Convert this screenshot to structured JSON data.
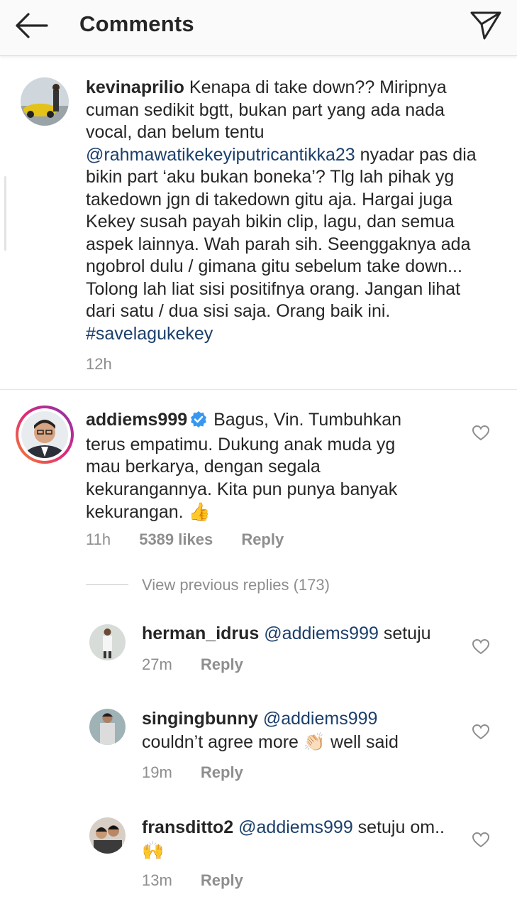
{
  "header": {
    "title": "Comments"
  },
  "main_comment": {
    "username": "kevinaprilio",
    "text_before": "Kenapa di take down?? Miripnya cuman sedikit bgtt, bukan part yang ada nada vocal, dan belum tentu ",
    "mention": "@rahmawatikekeyiputricantikka23",
    "text_after": " nyadar pas dia bikin part ‘aku bukan boneka’? Tlg lah pihak yg takedown jgn di takedown gitu aja. Hargai juga Kekey susah payah bikin clip, lagu, dan semua aspek lainnya. Wah parah sih. Seenggaknya ada ngobrol dulu / gimana gitu sebelum take down... Tolong lah liat sisi positifnya orang. Jangan lihat dari satu / dua sisi saja. Orang baik ini. ",
    "hashtag": "#savelagukekey",
    "time": "12h"
  },
  "reply_main": {
    "username": "addiems999",
    "text": "Bagus, Vin. Tumbuhkan terus empatimu.  Dukung anak muda yg mau berkarya, dengan segala kekurangannya. Kita pun punya banyak kekurangan.",
    "emoji": "👍",
    "time": "11h",
    "likes": "5389 likes",
    "reply_label": "Reply"
  },
  "view_previous": "View previous replies (173)",
  "replies": [
    {
      "username": "herman_idrus",
      "mention": "@addiems999",
      "text": " setuju",
      "emoji": "",
      "time": "27m",
      "reply_label": "Reply"
    },
    {
      "username": "singingbunny",
      "mention": "@addiems999",
      "text_line2": "couldn’t agree more",
      "emoji": "👏🏻",
      "text_end": " well said",
      "time": "19m",
      "reply_label": "Reply"
    },
    {
      "username": "fransditto2",
      "mention": "@addiems999",
      "text": " setuju om..",
      "emoji": "🙌",
      "time": "13m",
      "reply_label": "Reply"
    }
  ],
  "colors": {
    "mention": "#1b3f6b",
    "meta": "#8e8e8e",
    "verified": "#3897f0",
    "story_ring_start": "#f58529",
    "story_ring_end": "#dd2a7b"
  }
}
